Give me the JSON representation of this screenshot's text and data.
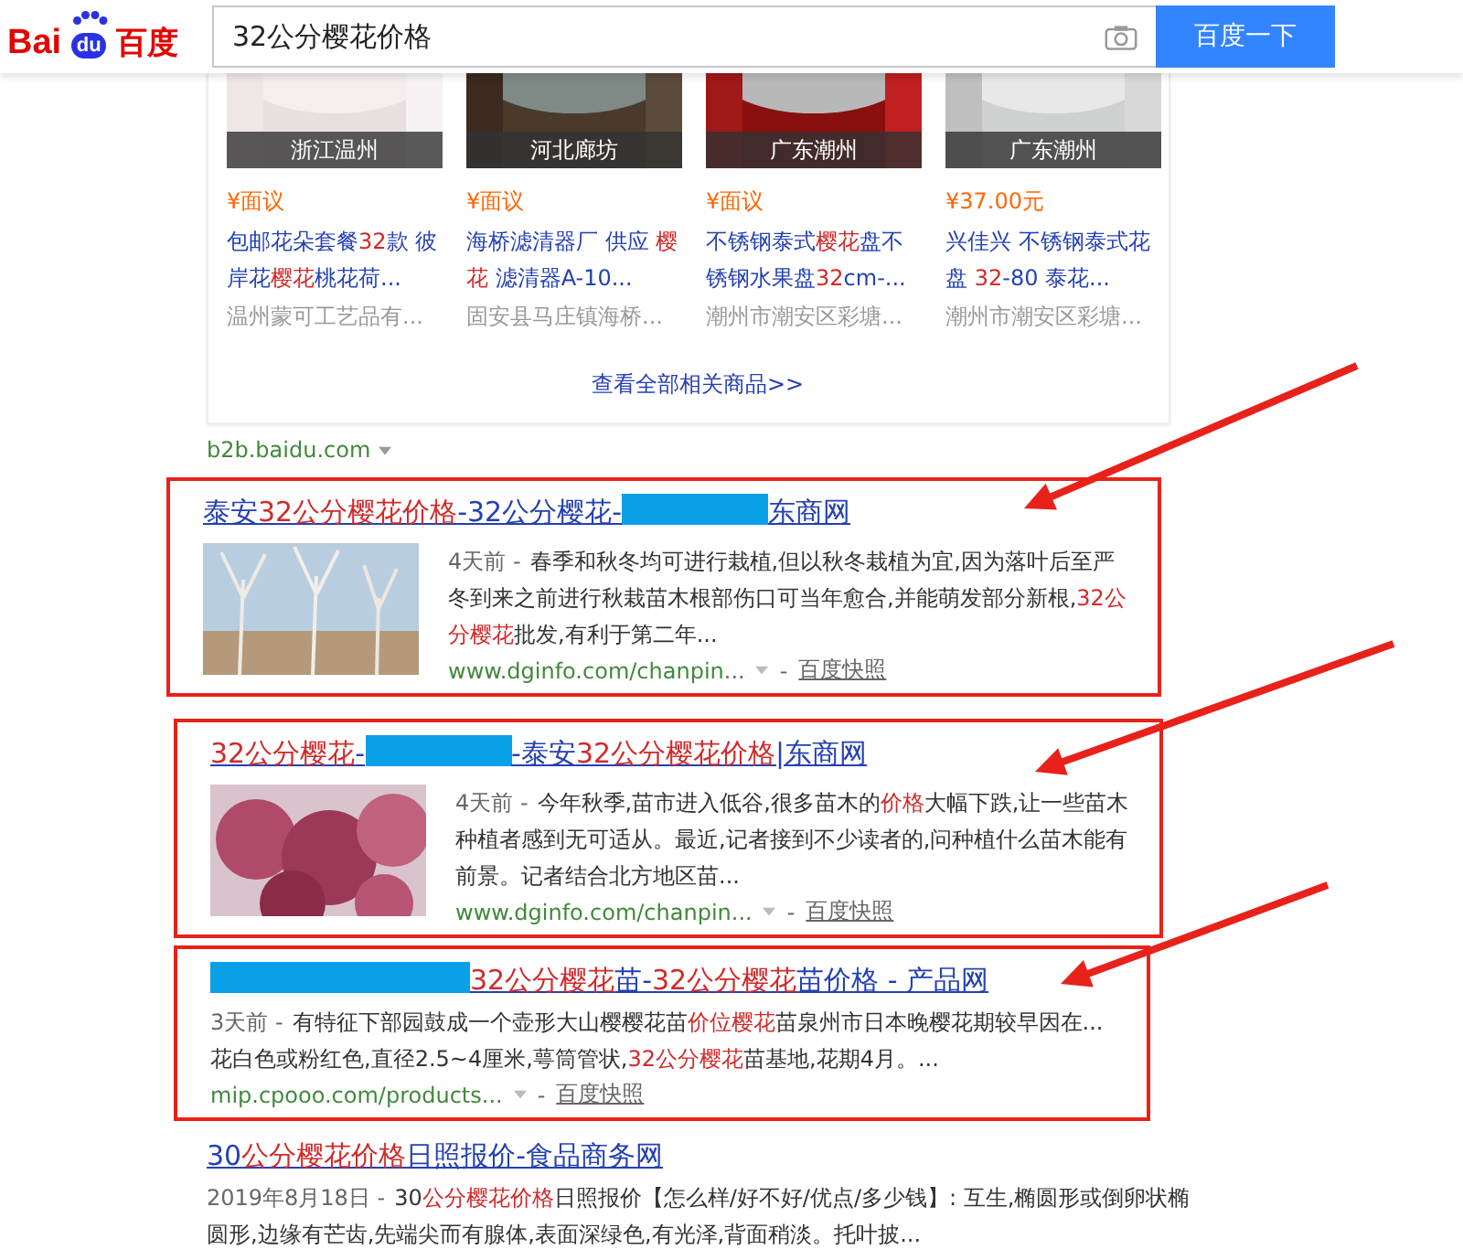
{
  "header": {
    "logo_left": "Bai",
    "logo_paw": "du",
    "logo_right": "百度",
    "query": "32公分樱花价格",
    "search_button": "百度一下"
  },
  "products": {
    "items": [
      {
        "location": "浙江温州",
        "price": "¥面议",
        "title": [
          {
            "kind": "text",
            "t": "包邮花朵套餐"
          },
          {
            "kind": "hit",
            "t": "32"
          },
          {
            "kind": "text",
            "t": "款 彼岸花"
          },
          {
            "kind": "hit",
            "t": "樱花"
          },
          {
            "kind": "text",
            "t": "桃花荷..."
          }
        ],
        "seller": "温州蒙可工艺品有..."
      },
      {
        "location": "河北廊坊",
        "price": "¥面议",
        "title": [
          {
            "kind": "text",
            "t": "海桥滤清器厂 供应 "
          },
          {
            "kind": "hit",
            "t": "樱花"
          },
          {
            "kind": "text",
            "t": " 滤清器A-10..."
          }
        ],
        "seller": "固安县马庄镇海桥..."
      },
      {
        "location": "广东潮州",
        "price": "¥面议",
        "title": [
          {
            "kind": "text",
            "t": "不锈钢泰式"
          },
          {
            "kind": "hit",
            "t": "樱花"
          },
          {
            "kind": "text",
            "t": "盘不锈钢水果盘"
          },
          {
            "kind": "hit",
            "t": "32"
          },
          {
            "kind": "text",
            "t": "cm-..."
          }
        ],
        "seller": "潮州市潮安区彩塘..."
      },
      {
        "location": "广东潮州",
        "price": "¥37.00元",
        "title": [
          {
            "kind": "text",
            "t": "兴佳兴 不锈钢泰式花盘 "
          },
          {
            "kind": "hit",
            "t": "32"
          },
          {
            "kind": "text",
            "t": "-80 泰花..."
          }
        ],
        "seller": "潮州市潮安区彩塘..."
      }
    ],
    "more_link": "查看全部相关商品>>",
    "source": "b2b.baidu.com"
  },
  "results": [
    {
      "highlighted": true,
      "title": [
        {
          "kind": "text",
          "t": "泰安"
        },
        {
          "kind": "hit",
          "t": "32公分樱花价格"
        },
        {
          "kind": "text",
          "t": "-32公分樱花-"
        },
        {
          "kind": "redacted"
        },
        {
          "kind": "text",
          "t": "东商网"
        }
      ],
      "thumbnail": {
        "kind": "picture"
      },
      "date": "4天前 -",
      "snippet": [
        {
          "kind": "text",
          "t": "春季和秋冬均可进行栽植,但以秋冬栽植为宜,因为落叶后至严冬到来之前进行秋栽苗木根部伤口可当年愈合,并能萌发部分新根,"
        },
        {
          "kind": "hit",
          "t": "32公分樱花"
        },
        {
          "kind": "text",
          "t": "批发,有利于第二年..."
        }
      ],
      "url": "www.dginfo.com/chanpin...",
      "separator": "-",
      "cache": "百度快照"
    },
    {
      "highlighted": true,
      "title": [
        {
          "kind": "hit",
          "t": "32公分樱花"
        },
        {
          "kind": "text",
          "t": "-"
        },
        {
          "kind": "redacted"
        },
        {
          "kind": "text",
          "t": "-泰安"
        },
        {
          "kind": "hit",
          "t": "32公分樱花价格"
        },
        {
          "kind": "text",
          "t": "|东商网"
        }
      ],
      "thumbnail": {
        "kind": "picture"
      },
      "date": "4天前 -",
      "snippet": [
        {
          "kind": "text",
          "t": "今年秋季,苗市进入低谷,很多苗木的"
        },
        {
          "kind": "hit",
          "t": "价格"
        },
        {
          "kind": "text",
          "t": "大幅下跌,让一些苗木种植者感到无可适从。最近,记者接到不少读者的,问种植什么苗木能有前景。记者结合北方地区苗..."
        }
      ],
      "url": "www.dginfo.com/chanpin...",
      "separator": "-",
      "cache": "百度快照"
    },
    {
      "highlighted": true,
      "title": [
        {
          "kind": "redacted"
        },
        {
          "kind": "hit",
          "t": "32公分樱花"
        },
        {
          "kind": "text",
          "t": "苗-"
        },
        {
          "kind": "hit",
          "t": "32公分樱花"
        },
        {
          "kind": "text",
          "t": "苗价格 - 产品网"
        }
      ],
      "date": "3天前 -",
      "snippet": [
        {
          "kind": "text",
          "t": "有特征下部园鼓成一个壶形大山樱樱花苗"
        },
        {
          "kind": "hit",
          "t": "价位樱花"
        },
        {
          "kind": "text",
          "t": "苗泉州市日本晚樱花期较早因在...花白色或粉红色,直径2.5~4厘米,萼筒管状,"
        },
        {
          "kind": "hit",
          "t": "32公分樱花"
        },
        {
          "kind": "text",
          "t": "苗基地,花期4月。..."
        }
      ],
      "url": "mip.cpooo.com/products...",
      "separator": "-",
      "cache": "百度快照"
    },
    {
      "title": [
        {
          "kind": "text",
          "t": "30"
        },
        {
          "kind": "hit",
          "t": "公分樱花价格"
        },
        {
          "kind": "text",
          "t": "日照报价-食品商务网"
        }
      ],
      "date": "2019年8月18日 -",
      "snippet": [
        {
          "kind": "text",
          "t": "30"
        },
        {
          "kind": "hit",
          "t": "公分樱花价格"
        },
        {
          "kind": "text",
          "t": "日照报价【怎么样/好不好/优点/多少钱】: 互生,椭圆形或倒卵状椭圆形,边缘有芒齿,先端尖而有腺体,表面深绿色,有光泽,背面稍淡。托叶披..."
        }
      ]
    }
  ],
  "annotations": [
    {
      "kind": "arrow"
    },
    {
      "kind": "arrow"
    },
    {
      "kind": "arrow"
    }
  ]
}
